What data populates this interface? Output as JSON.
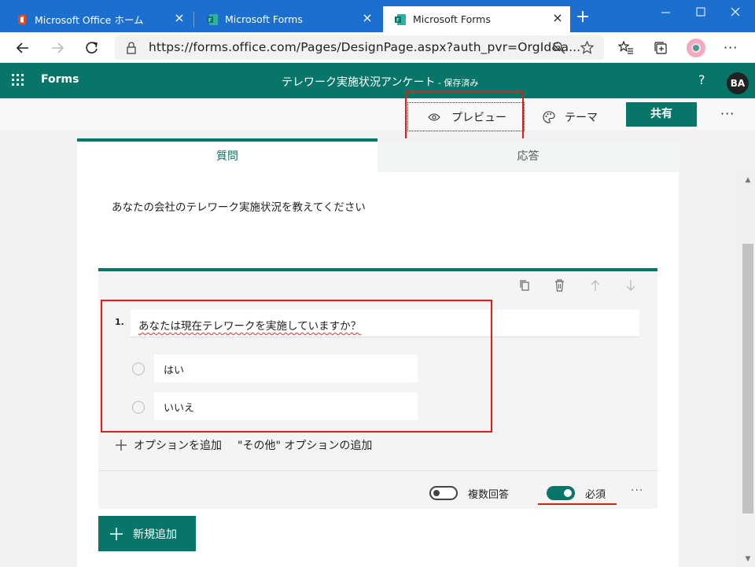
{
  "browser": {
    "tabs": [
      {
        "label": "Microsoft Office ホーム",
        "icon": "office-icon"
      },
      {
        "label": "Microsoft Forms",
        "icon": "forms-icon"
      },
      {
        "label": "Microsoft Forms",
        "icon": "forms-icon"
      }
    ],
    "active_tab": 2,
    "url": "https://forms.office.com/Pages/DesignPage.aspx?auth_pvr=OrgId&a..."
  },
  "forms_header": {
    "app_name": "Forms",
    "doc_title": "テレワーク実施状況アンケート",
    "doc_status": " - 保存済み",
    "help": "?",
    "avatar": "BA"
  },
  "command_bar": {
    "preview_label": "プレビュー",
    "theme_label": "テーマ",
    "share_label": "共有",
    "more": "···"
  },
  "form": {
    "tabs": {
      "questions": "質問",
      "responses": "応答"
    },
    "description": "あなたの会社のテレワーク実施状況を教えてください",
    "question": {
      "number": "1.",
      "text": "あなたは現在テレワークを実施していますか？",
      "options": [
        "はい",
        "いいえ"
      ],
      "add_option": "オプションを追加",
      "add_other": "\"その他\" オプションの追加",
      "multiple_answers_label": "複数回答",
      "multiple_answers_on": false,
      "required_label": "必須",
      "required_on": true,
      "more": "···"
    },
    "add_new_label": "新規追加"
  },
  "colors": {
    "brand": "#077568",
    "browser_chrome": "#1d6fcf",
    "highlight": "#e01c1c"
  }
}
